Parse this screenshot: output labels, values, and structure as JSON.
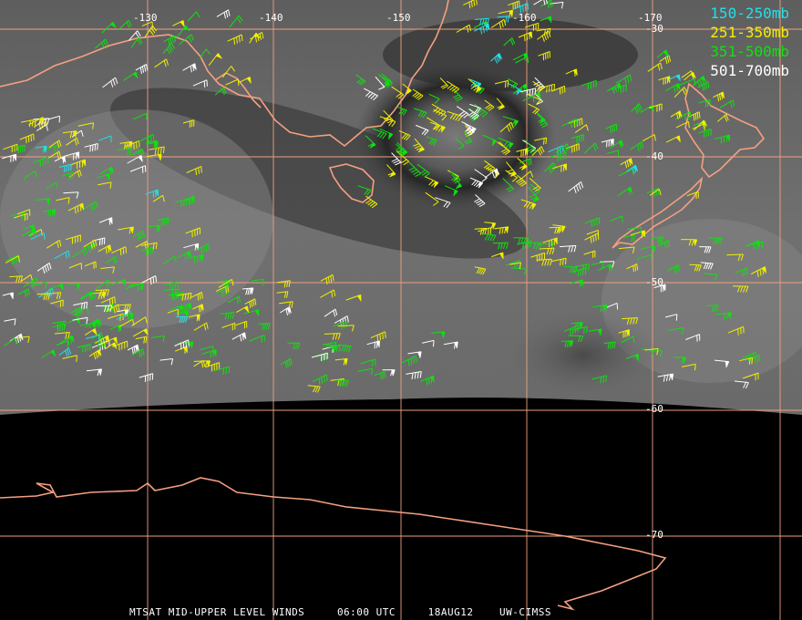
{
  "colors": {
    "grid": "#f0a080",
    "coast": "#f4a080",
    "level1": "#22e0e8",
    "level2": "#f0f000",
    "level3": "#10e010",
    "level4": "#ffffff"
  },
  "legend": [
    {
      "label": "150-250mb",
      "color": "#22e0e8"
    },
    {
      "label": "251-350mb",
      "color": "#f0f000"
    },
    {
      "label": "351-500mb",
      "color": "#10e010"
    },
    {
      "label": "501-700mb",
      "color": "#ffffff"
    }
  ],
  "longitude_ticks": [
    "-130",
    "-140",
    "-150",
    "-160",
    "-170"
  ],
  "latitude_ticks": [
    "-30",
    "-40",
    "-50",
    "-60",
    "-70"
  ],
  "caption": {
    "satellite": "MTSAT MID-UPPER LEVEL WINDS",
    "time": "06:00 UTC",
    "date": "18AUG12",
    "source": "UW-CIMSS"
  }
}
